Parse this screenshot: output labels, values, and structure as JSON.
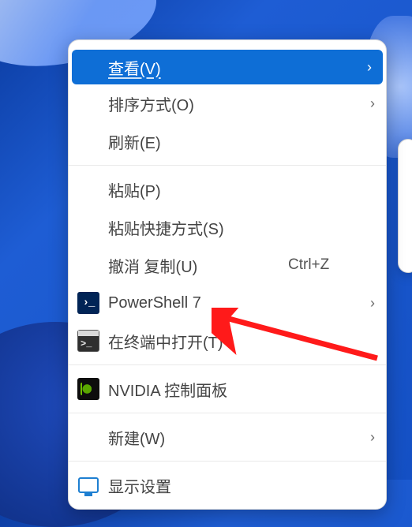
{
  "background": {
    "style": "windows11-bloom",
    "primary_color": "#1e5dd4"
  },
  "side_bubble_visible": "true",
  "menu": {
    "view": {
      "label": "查看(V)"
    },
    "sort": {
      "label": "排序方式(O)"
    },
    "refresh": {
      "label": "刷新(E)"
    },
    "paste": {
      "label": "粘贴(P)"
    },
    "paste_shortcut": {
      "label": "粘贴快捷方式(S)"
    },
    "undo_copy": {
      "label": "撤消 复制(U)",
      "shortcut": "Ctrl+Z"
    },
    "powershell": {
      "label": "PowerShell 7"
    },
    "open_in_terminal": {
      "label": "在终端中打开(T)"
    },
    "nvidia": {
      "label": "NVIDIA 控制面板"
    },
    "new": {
      "label": "新建(W)"
    },
    "display_settings": {
      "label": "显示设置"
    }
  },
  "annotation": {
    "target": "open_in_terminal",
    "color": "#ff1a1a"
  }
}
